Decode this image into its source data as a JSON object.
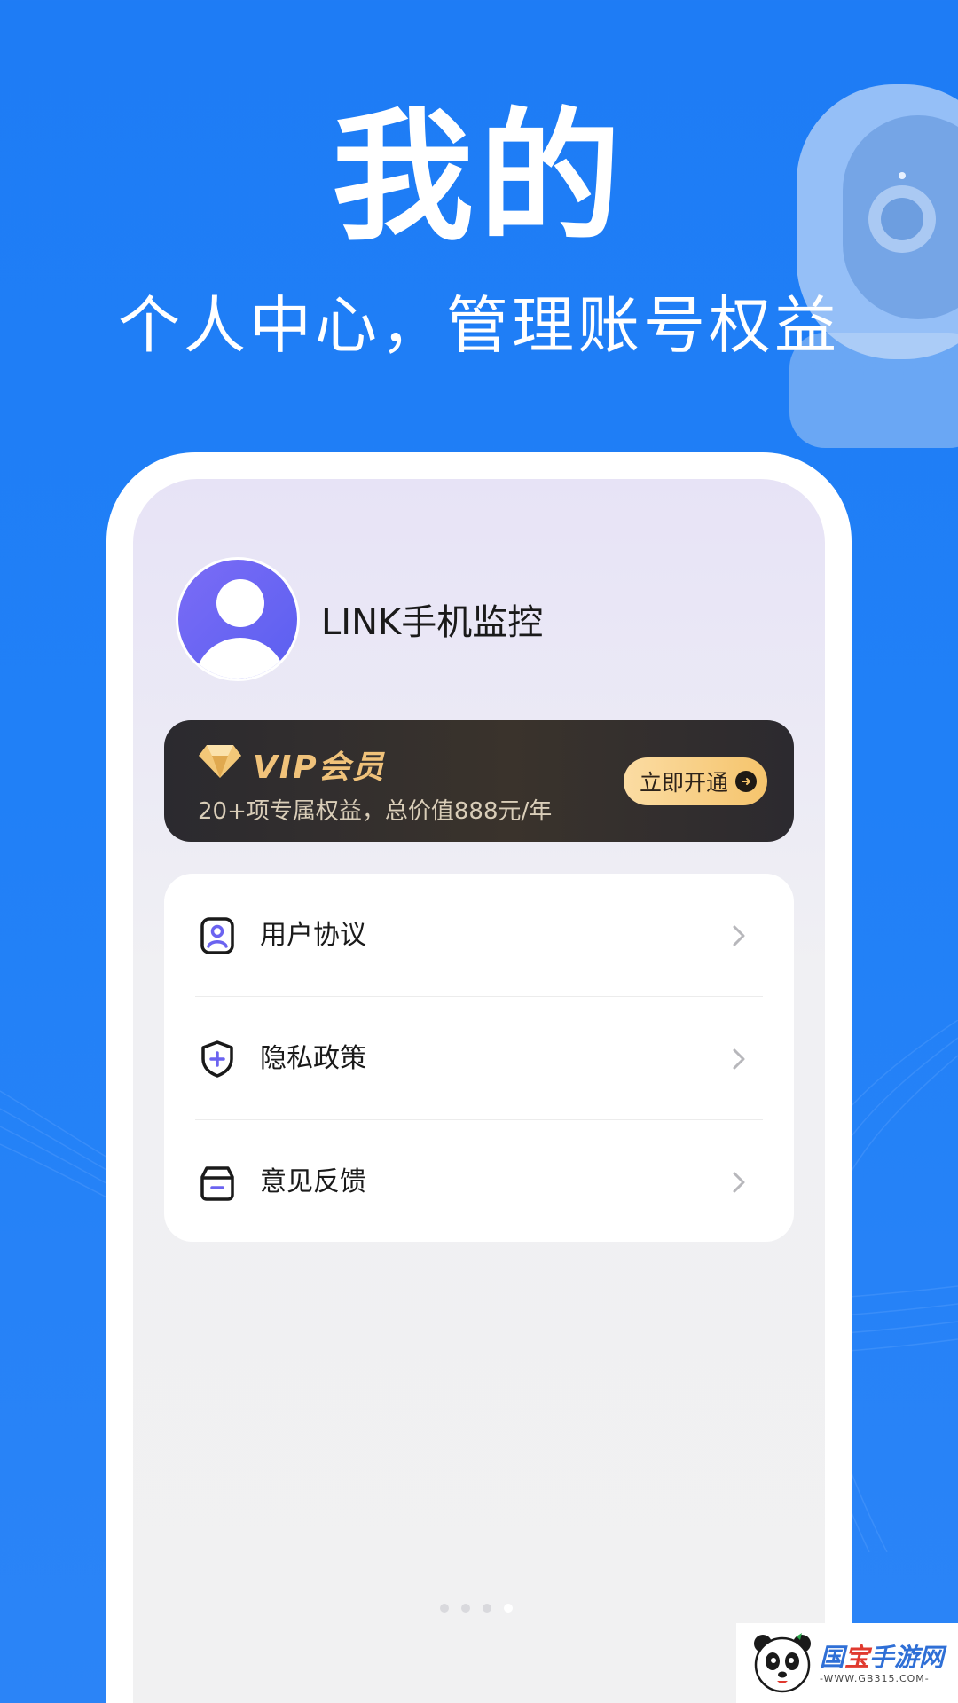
{
  "hero": {
    "title": "我的",
    "subtitle": "个人中心，管理账号权益"
  },
  "profile": {
    "username": "LINK手机监控",
    "avatar_icon": "user-avatar-icon"
  },
  "vip": {
    "title": "VIP会员",
    "description": "20+项专属权益，总价值888元/年",
    "button_label": "立即开通",
    "accent_color": "#f0c27a"
  },
  "menu": {
    "items": [
      {
        "label": "用户协议",
        "icon": "user-agreement-icon"
      },
      {
        "label": "隐私政策",
        "icon": "shield-plus-icon"
      },
      {
        "label": "意见反馈",
        "icon": "feedback-box-icon"
      }
    ]
  },
  "pager": {
    "total": 4,
    "active_index": 3
  },
  "watermark": {
    "name_part1": "国",
    "name_part2": "宝",
    "name_part3": "手游网",
    "url": "-WWW.GB315.COM-"
  },
  "colors": {
    "background": "#1e7cf5",
    "menu_icon_accent": "#6b63f0",
    "vip_button": "#f5c46c"
  }
}
